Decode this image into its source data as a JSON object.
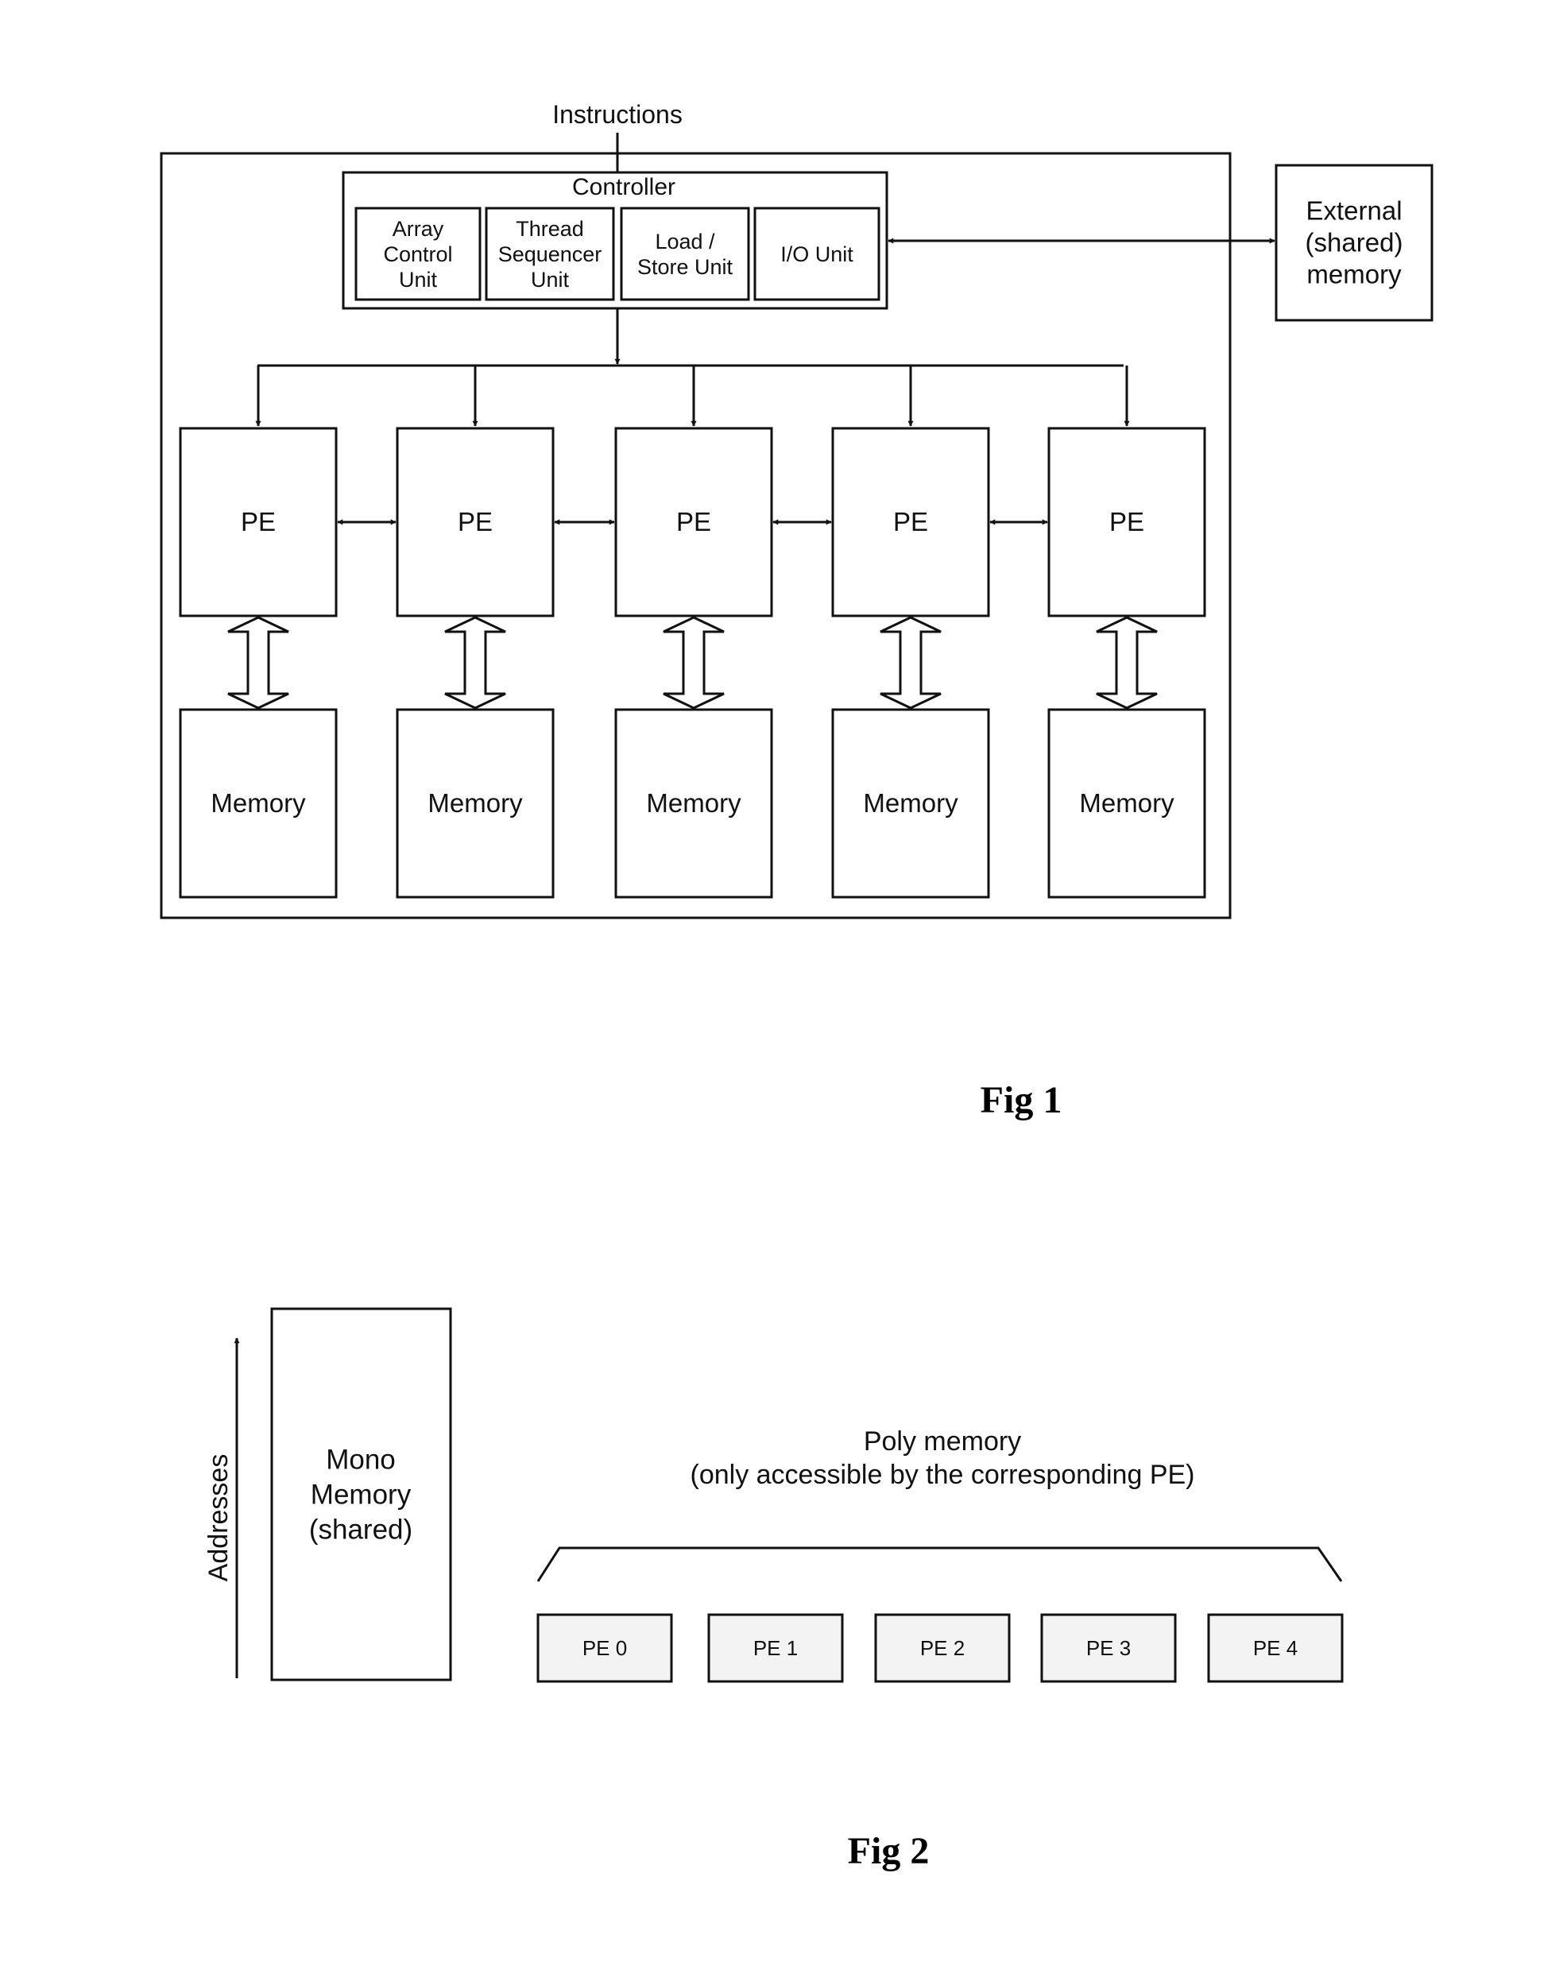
{
  "fig1": {
    "caption": "Fig 1",
    "instructions_label": "Instructions",
    "controller": {
      "title": "Controller",
      "units": [
        {
          "lines": [
            "Array",
            "Control",
            "Unit"
          ]
        },
        {
          "lines": [
            "Thread",
            "Sequencer",
            "Unit"
          ]
        },
        {
          "lines": [
            "Load /",
            "Store Unit"
          ]
        },
        {
          "lines": [
            "I/O Unit"
          ]
        }
      ]
    },
    "external_memory": {
      "lines": [
        "External",
        "(shared)",
        "memory"
      ]
    },
    "pe_label": "PE",
    "memory_label": "Memory",
    "pe_count": 5
  },
  "fig2": {
    "caption": "Fig 2",
    "addresses_label": "Addresses",
    "mono_memory": {
      "lines": [
        "Mono",
        "Memory",
        "(shared)"
      ]
    },
    "poly_memory": {
      "lines": [
        "Poly memory",
        "(only accessible by the corresponding PE)"
      ]
    },
    "pe_blocks": [
      "PE 0",
      "PE 1",
      "PE 2",
      "PE 3",
      "PE 4"
    ]
  }
}
